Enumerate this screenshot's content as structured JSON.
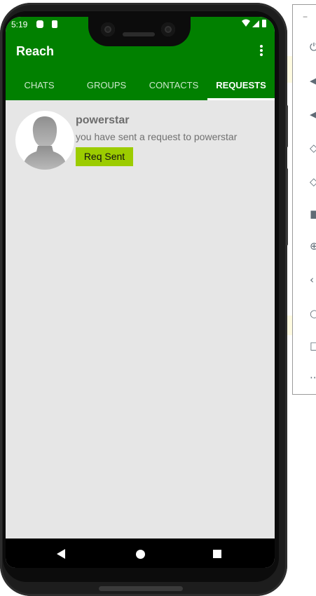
{
  "status_bar": {
    "time": "5:19"
  },
  "app": {
    "title": "Reach",
    "tabs": [
      {
        "label": "CHATS",
        "active": false
      },
      {
        "label": "GROUPS",
        "active": false
      },
      {
        "label": "CONTACTS",
        "active": false
      },
      {
        "label": "REQUESTS",
        "active": true
      }
    ]
  },
  "requests": [
    {
      "name": "powerstar",
      "message": "you have sent a request to powerstar",
      "button_label": "Req Sent"
    }
  ],
  "colors": {
    "app_bar": "#018000",
    "content_bg": "#e6e6e6",
    "request_button": "#9ccc00"
  },
  "emulator_toolbar": {
    "minimize": "−",
    "icons": [
      "power-icon",
      "volume-up-icon",
      "volume-down-icon",
      "rotate-left-icon",
      "rotate-right-icon",
      "camera-icon",
      "zoom-icon",
      "back-icon",
      "home-icon",
      "overview-icon",
      "more-icon"
    ]
  }
}
